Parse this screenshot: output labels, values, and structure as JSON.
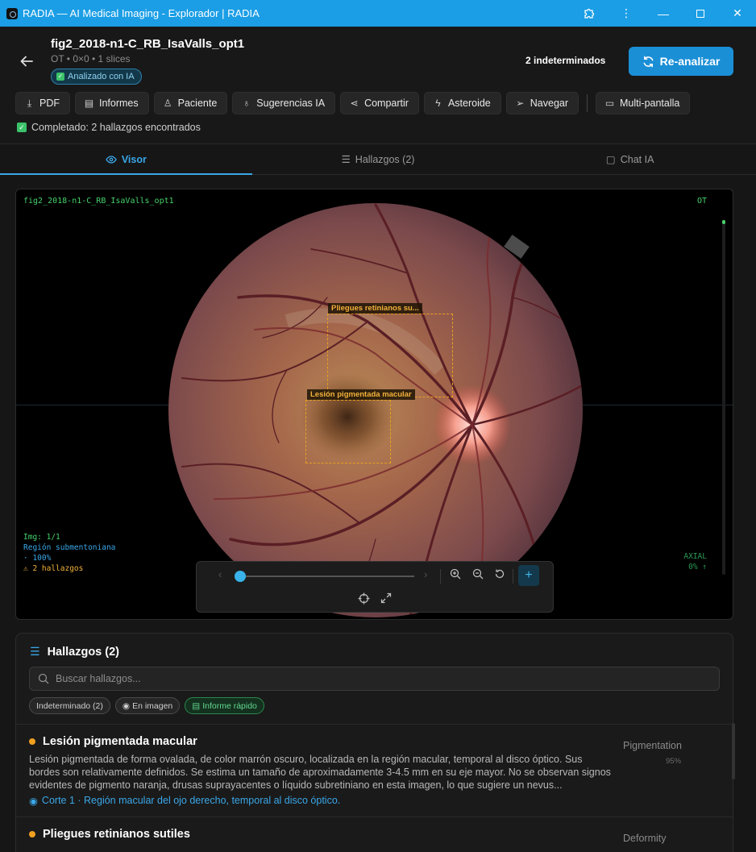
{
  "window": {
    "title": "RADIA — AI Medical Imaging - Explorador | RADIA"
  },
  "study": {
    "title": "fig2_2018-n1-C_RB_IsaValls_opt1",
    "meta": "OT • 0×0 • 1 slices",
    "badge": "Analizado con IA",
    "indeterminate": "2 indeterminados",
    "reanalyze": "Re-analizar",
    "status": "Completado: 2 hallazgos encontrados"
  },
  "toolbar": [
    "PDF",
    "Informes",
    "Paciente",
    "Sugerencias IA",
    "Compartir",
    "Asteroide",
    "Navegar",
    "Multi-pantalla"
  ],
  "tabs": {
    "viewer": "Visor",
    "findings": "Hallazgos (2)",
    "chat": "Chat IA"
  },
  "viewer": {
    "name": "fig2_2018-n1-C_RB_IsaValls_opt1",
    "modality": "OT",
    "img": "Img: 1/1",
    "region": "Región submentoniana",
    "zoom": "· 100%",
    "count": "⚠ 2 hallazgos",
    "plane": "AXIAL",
    "pos": "0% ↑",
    "box1": "Pliegues retinianos su...",
    "box2": "Lesión pigmentada macular",
    "slice_position": 0
  },
  "findings": {
    "header": "Hallazgos (2)",
    "search_placeholder": "Buscar hallazgos...",
    "chips": {
      "indet": "Indeterminado (2)",
      "image": "En imagen",
      "report": "Informe rápido"
    },
    "items": [
      {
        "title": "Lesión pigmentada macular",
        "desc": "Lesión pigmentada de forma ovalada, de color marrón oscuro, localizada en la región macular, temporal al disco óptico. Sus bordes son relativamente definidos. Se estima un tamaño de aproximadamente 3-4.5 mm en su eje mayor. No se observan signos evidentes de pigmento naranja, drusas suprayacentes o líquido subretiniano en esta imagen, lo que sugiere un nevus...",
        "loc": "Corte 1 · Región macular del ojo derecho, temporal al disco óptico.",
        "category": "Pigmentation",
        "confidence": "95%"
      },
      {
        "title": "Pliegues retinianos sutiles",
        "category": "Deformity"
      }
    ]
  }
}
